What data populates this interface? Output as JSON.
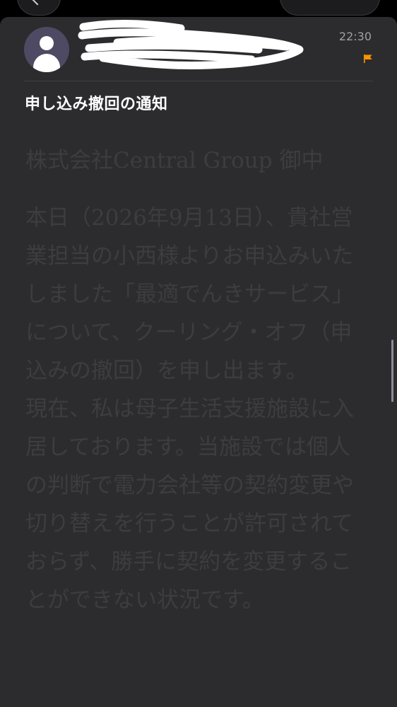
{
  "header": {
    "sender_name": "",
    "sender_email": "",
    "time": "22:30"
  },
  "icons": {
    "back": "chevron-left-icon",
    "avatar": "person-icon",
    "flag": "flag-icon"
  },
  "colors": {
    "background": "#000000",
    "card": "#2c2c2e",
    "flag": "#ff9500",
    "avatar": "#4e4a63"
  },
  "email": {
    "subject": "申し込み撤回の通知",
    "greeting": "株式会社Central Group 御中",
    "paragraph1": "本日（2026年9月13日）、貴社営業担当の小西様よりお申込みいたしました「最適でんきサービス」について、クーリング・オフ（申込みの撤回）を申し出ます。",
    "paragraph2": "現在、私は母子生活支援施設に入居しております。当施設では個人の判断で電力会社等の契約変更や切り替えを行うことが許可されておらず、勝手に契約を変更することができない状況です。"
  }
}
